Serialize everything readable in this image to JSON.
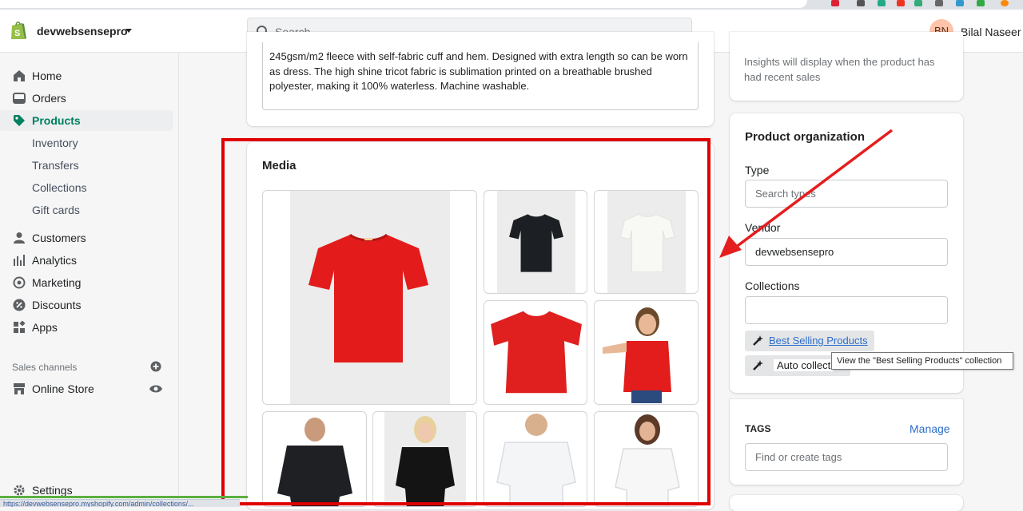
{
  "header": {
    "store_name": "devwebsensepro",
    "search_placeholder": "Search",
    "avatar_initials": "BN",
    "user_name": "Bilal Naseer"
  },
  "sidebar": {
    "home": "Home",
    "orders": "Orders",
    "products": "Products",
    "inventory": "Inventory",
    "transfers": "Transfers",
    "collections": "Collections",
    "gift_cards": "Gift cards",
    "customers": "Customers",
    "analytics": "Analytics",
    "marketing": "Marketing",
    "discounts": "Discounts",
    "apps": "Apps",
    "sales_channels": "Sales channels",
    "online_store": "Online Store",
    "settings": "Settings"
  },
  "description": {
    "text": "245gsm/m2 fleece with self-fabric cuff and hem. Designed with extra length so can be worn as dress. The high shine tricot fabric is sublimation printed on a breathable brushed polyester, making it 100% waterless. Machine washable."
  },
  "media": {
    "title": "Media"
  },
  "insights": {
    "text": "Insights will display when the product has had recent sales"
  },
  "organization": {
    "title": "Product organization",
    "type_label": "Type",
    "type_placeholder": "Search types",
    "vendor_label": "Vendor",
    "vendor_value": "devwebsensepro",
    "collections_label": "Collections",
    "collection_link": "Best Selling Products",
    "auto_collection": "Auto collect",
    "tooltip": "View the \"Best Selling Products\" collection"
  },
  "tags": {
    "title": "TAGS",
    "manage": "Manage",
    "placeholder": "Find or create tags"
  },
  "status_bar": {
    "url": "https://devwebsensepro.myshopify.com/admin/collections/..."
  },
  "colors": {
    "accent": "#008060",
    "highlight_frame": "#e00000",
    "link": "#2c6ecb"
  }
}
